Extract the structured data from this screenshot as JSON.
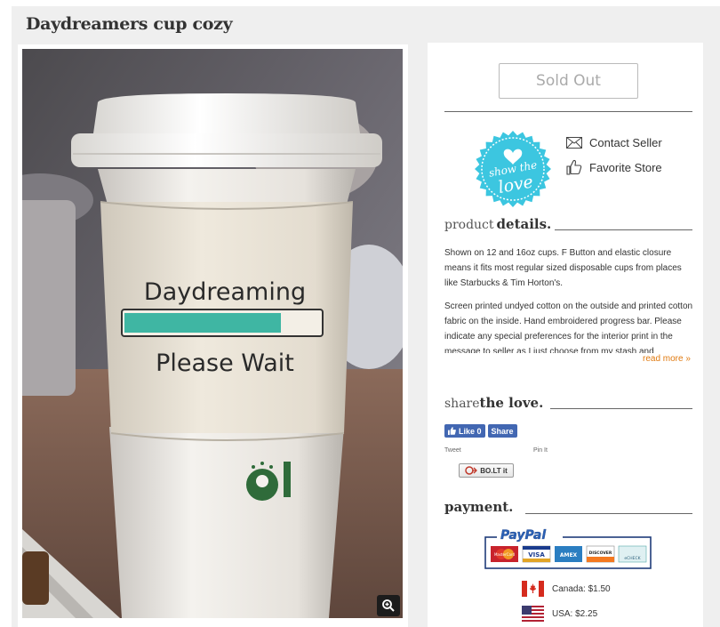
{
  "listing": {
    "title": "Daydreamers cup cozy"
  },
  "photo": {
    "cozy_line1": "Daydreaming",
    "cozy_line2": "Please Wait",
    "progress": 0.8,
    "colors": {
      "progress": "#3fb6a3",
      "cozy": "#efe9dd"
    }
  },
  "purchase": {
    "sold_out_label": "Sold Out"
  },
  "badge": {
    "line1": "show the",
    "line2": "love",
    "color": "#3cc6e0"
  },
  "seller": {
    "contact_label": "Contact Seller",
    "favorite_label": "Favorite Store"
  },
  "details": {
    "heading_light": "product",
    "heading_bold": "details.",
    "paragraphs": [
      "Shown on 12 and 16oz cups. F Button and elastic closure means it fits most regular sized disposable cups from places like Starbucks & Tim Horton's.",
      "Screen printed undyed cotton on the outside and printed cotton fabric on the inside. Hand embroidered progress bar. Please indicate any special preferences for the interior print in the message to seller as I just choose from my stash and"
    ],
    "read_more": "read more »"
  },
  "share": {
    "heading_light": "share",
    "heading_bold": "the love.",
    "like_label": "Like 0",
    "share_label": "Share",
    "tweet_label": "Tweet",
    "pin_label": "Pin It",
    "boltit_label": "BO.LT it"
  },
  "payment": {
    "heading": "payment.",
    "paypal_label": "PayPal",
    "cards": [
      "MasterCard",
      "VISA",
      "AMEX",
      "DISCOVER",
      "eCHECK"
    ],
    "shipping": [
      {
        "label": "Canada: $1.50",
        "flag": "canada-flag"
      },
      {
        "label": "USA: $2.25",
        "flag": "usa-flag"
      }
    ]
  },
  "icons": {
    "zoom": "zoom-in-icon",
    "contact": "envelope-icon",
    "favorite": "thumbs-up-icon",
    "like": "thumbs-up-icon"
  }
}
